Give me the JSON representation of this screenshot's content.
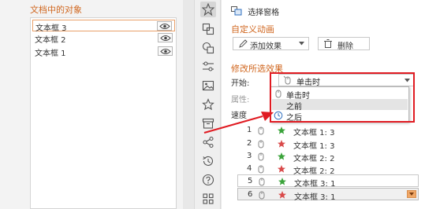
{
  "selection_pane": {
    "title": "文档中的对象",
    "objects": [
      {
        "name": "文本框 3",
        "visible_icon": "eye-icon"
      },
      {
        "name": "文本框 2",
        "visible_icon": "eye-icon"
      },
      {
        "name": "文本框 1",
        "visible_icon": "eye-icon"
      }
    ]
  },
  "sidebar_icons": [
    "animation-star-icon",
    "transition-icon",
    "shapes-icon",
    "settings-sliders-icon",
    "image-gallery-icon",
    "star-icon",
    "box-icon",
    "share-icon",
    "history-icon",
    "help-icon",
    "apps-grid-icon"
  ],
  "animation_pane": {
    "selection_window_label": "选择窗格",
    "custom_animation_title": "自定义动画",
    "add_effect_label": "添加效果",
    "delete_label": "删除",
    "modify_title": "修改所选效果",
    "start_label": "开始:",
    "start_value": "单击时",
    "property_label": "属性:",
    "speed_label": "速度",
    "start_options": [
      "单击时",
      "之前",
      "之后"
    ],
    "animations": [
      {
        "num": "1",
        "name": "文本框 1: 3"
      },
      {
        "num": "2",
        "name": "文本框 1: 3"
      },
      {
        "num": "3",
        "name": "文本框 2: 2"
      },
      {
        "num": "4",
        "name": "文本框 2: 2"
      },
      {
        "num": "5",
        "name": "文本框 3: 1"
      },
      {
        "num": "6",
        "name": "文本框 3: 1"
      }
    ]
  },
  "colors": {
    "accent_orange": "#d0661e",
    "highlight_red": "#e01b22",
    "entrance_green": "#3aa33a",
    "emphasis_red": "#d94a4a"
  }
}
